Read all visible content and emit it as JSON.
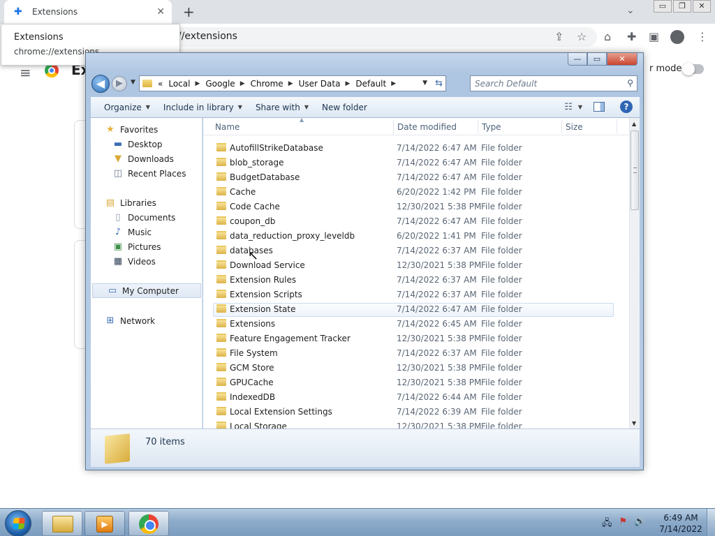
{
  "chrome": {
    "tab_title": "Extensions",
    "tab_close": "✕",
    "new_tab": "+",
    "tab_search": "⌄",
    "window_controls": [
      "▭",
      "❐",
      "✕"
    ],
    "address_tail": "//extensions",
    "page_title": "Ex",
    "dev_mode_label": "r mode",
    "tooltip": {
      "title": "Extensions",
      "url": "chrome://extensions"
    },
    "toolbar_icons": {
      "share": "⇪",
      "star": "☆",
      "home": "⌂",
      "extensions": "✚",
      "sidepanel": "▣",
      "menu": "⋮"
    },
    "menu_icon": "≡"
  },
  "explorer": {
    "caption_buttons": {
      "minimize": "—",
      "maximize": "▭",
      "close": "✕"
    },
    "nav": {
      "back": "◀",
      "forward": "▶",
      "drop": "▼"
    },
    "address": {
      "lead": "«",
      "crumbs": [
        "Local",
        "Google",
        "Chrome",
        "User Data",
        "Default"
      ],
      "sep": "▶",
      "drop": "▼",
      "refresh": "⇆"
    },
    "search": {
      "placeholder": "Search Default",
      "icon": "⚲"
    },
    "commands": {
      "organize": "Organize",
      "include_in_library": "Include in library",
      "share_with": "Share with",
      "new_folder": "New folder",
      "arrow": "▼",
      "views_icon": "☷",
      "views_arrow": "▼",
      "help": "?"
    },
    "nav_pane": {
      "favorites": {
        "label": "Favorites",
        "items": [
          "Desktop",
          "Downloads",
          "Recent Places"
        ]
      },
      "libraries": {
        "label": "Libraries",
        "items": [
          "Documents",
          "Music",
          "Pictures",
          "Videos"
        ]
      },
      "computer": "My Computer",
      "network": "Network"
    },
    "columns": {
      "name": "Name",
      "date": "Date modified",
      "type": "Type",
      "size": "Size",
      "sort": "▲"
    },
    "rows": [
      {
        "name": "AutofillStrikeDatabase",
        "date": "7/14/2022 6:47 AM",
        "type": "File folder"
      },
      {
        "name": "blob_storage",
        "date": "7/14/2022 6:47 AM",
        "type": "File folder"
      },
      {
        "name": "BudgetDatabase",
        "date": "7/14/2022 6:47 AM",
        "type": "File folder"
      },
      {
        "name": "Cache",
        "date": "6/20/2022 1:42 PM",
        "type": "File folder"
      },
      {
        "name": "Code Cache",
        "date": "12/30/2021 5:38 PM",
        "type": "File folder"
      },
      {
        "name": "coupon_db",
        "date": "7/14/2022 6:47 AM",
        "type": "File folder"
      },
      {
        "name": "data_reduction_proxy_leveldb",
        "date": "6/20/2022 1:41 PM",
        "type": "File folder"
      },
      {
        "name": "databases",
        "date": "7/14/2022 6:37 AM",
        "type": "File folder"
      },
      {
        "name": "Download Service",
        "date": "12/30/2021 5:38 PM",
        "type": "File folder"
      },
      {
        "name": "Extension Rules",
        "date": "7/14/2022 6:37 AM",
        "type": "File folder"
      },
      {
        "name": "Extension Scripts",
        "date": "7/14/2022 6:37 AM",
        "type": "File folder"
      },
      {
        "name": "Extension State",
        "date": "7/14/2022 6:47 AM",
        "type": "File folder"
      },
      {
        "name": "Extensions",
        "date": "7/14/2022 6:45 AM",
        "type": "File folder"
      },
      {
        "name": "Feature Engagement Tracker",
        "date": "12/30/2021 5:38 PM",
        "type": "File folder"
      },
      {
        "name": "File System",
        "date": "7/14/2022 6:37 AM",
        "type": "File folder"
      },
      {
        "name": "GCM Store",
        "date": "12/30/2021 5:38 PM",
        "type": "File folder"
      },
      {
        "name": "GPUCache",
        "date": "12/30/2021 5:38 PM",
        "type": "File folder"
      },
      {
        "name": "IndexedDB",
        "date": "7/14/2022 6:44 AM",
        "type": "File folder"
      },
      {
        "name": "Local Extension Settings",
        "date": "7/14/2022 6:39 AM",
        "type": "File folder"
      },
      {
        "name": "Local Storage",
        "date": "12/30/2021 5:38 PM",
        "type": "File folder"
      }
    ],
    "scroll": {
      "up": "▲",
      "down": "▼"
    },
    "details": {
      "item_count": "70 items"
    }
  },
  "taskbar": {
    "media_icon": "▶",
    "tray": {
      "network": "🖧",
      "flag": "⚑",
      "volume": "🔊"
    },
    "clock": {
      "time": "6:49 AM",
      "date": "7/14/2022"
    }
  },
  "cursor": "↖",
  "colors": {
    "explorer_frame": "#b9cde6",
    "taskbar": "#8eabc9",
    "chrome_tabstrip": "#dee1e6",
    "selection": "#cddcee"
  }
}
